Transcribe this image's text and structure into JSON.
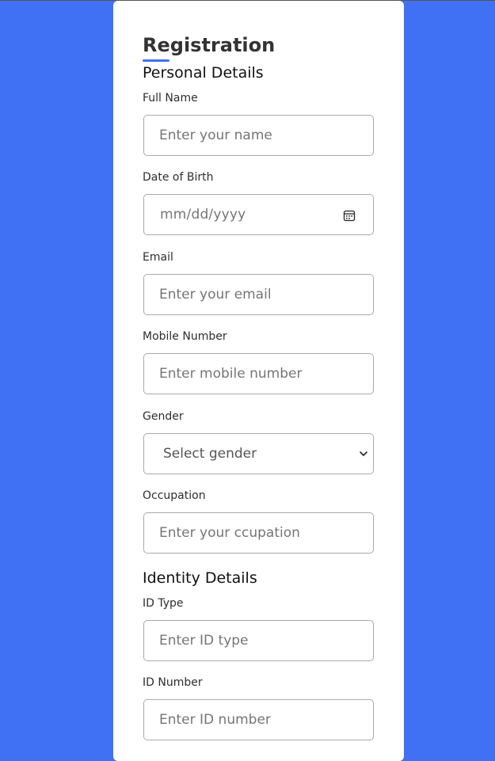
{
  "form": {
    "title": "Registration",
    "sections": {
      "personal": "Personal Details",
      "identity": "Identity Details"
    },
    "fields": {
      "full_name": {
        "label": "Full Name",
        "placeholder": "Enter your name"
      },
      "dob": {
        "label": "Date of Birth",
        "display": "mm/dd/yyyy",
        "icon": "calendar-icon"
      },
      "email": {
        "label": "Email",
        "placeholder": "Enter your email"
      },
      "mobile": {
        "label": "Mobile Number",
        "placeholder": "Enter mobile number"
      },
      "gender": {
        "label": "Gender",
        "selected": "Select gender",
        "icon": "chevron-down-icon"
      },
      "occupation": {
        "label": "Occupation",
        "placeholder": "Enter your ccupation"
      },
      "id_type": {
        "label": "ID Type",
        "placeholder": "Enter ID type"
      },
      "id_number": {
        "label": "ID Number",
        "placeholder": "Enter ID number"
      }
    }
  },
  "colors": {
    "background": "#4070f4",
    "accent": "#4070f4",
    "card": "#ffffff"
  }
}
